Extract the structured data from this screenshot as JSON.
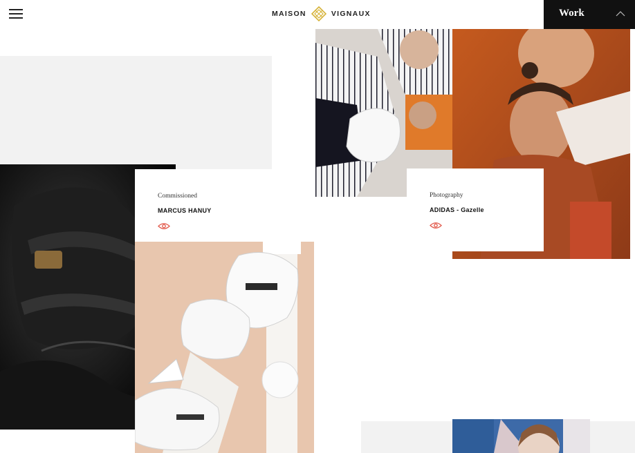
{
  "header": {
    "brand_left": "MAISON",
    "brand_right": "VIGNAUX",
    "work_label": "Work",
    "accent_color": "#d6b33a",
    "menu_icon": "hamburger-icon"
  },
  "projects": [
    {
      "category": "Commissioned",
      "title": "MARCUS HANUY",
      "view_icon": "eye-icon"
    },
    {
      "category": "Photography",
      "title": "ADIDAS - Gazelle",
      "view_icon": "eye-icon"
    }
  ],
  "colors": {
    "eye": "#e2584a",
    "grey_tile": "#f2f2f2",
    "work_bg": "#111111"
  }
}
